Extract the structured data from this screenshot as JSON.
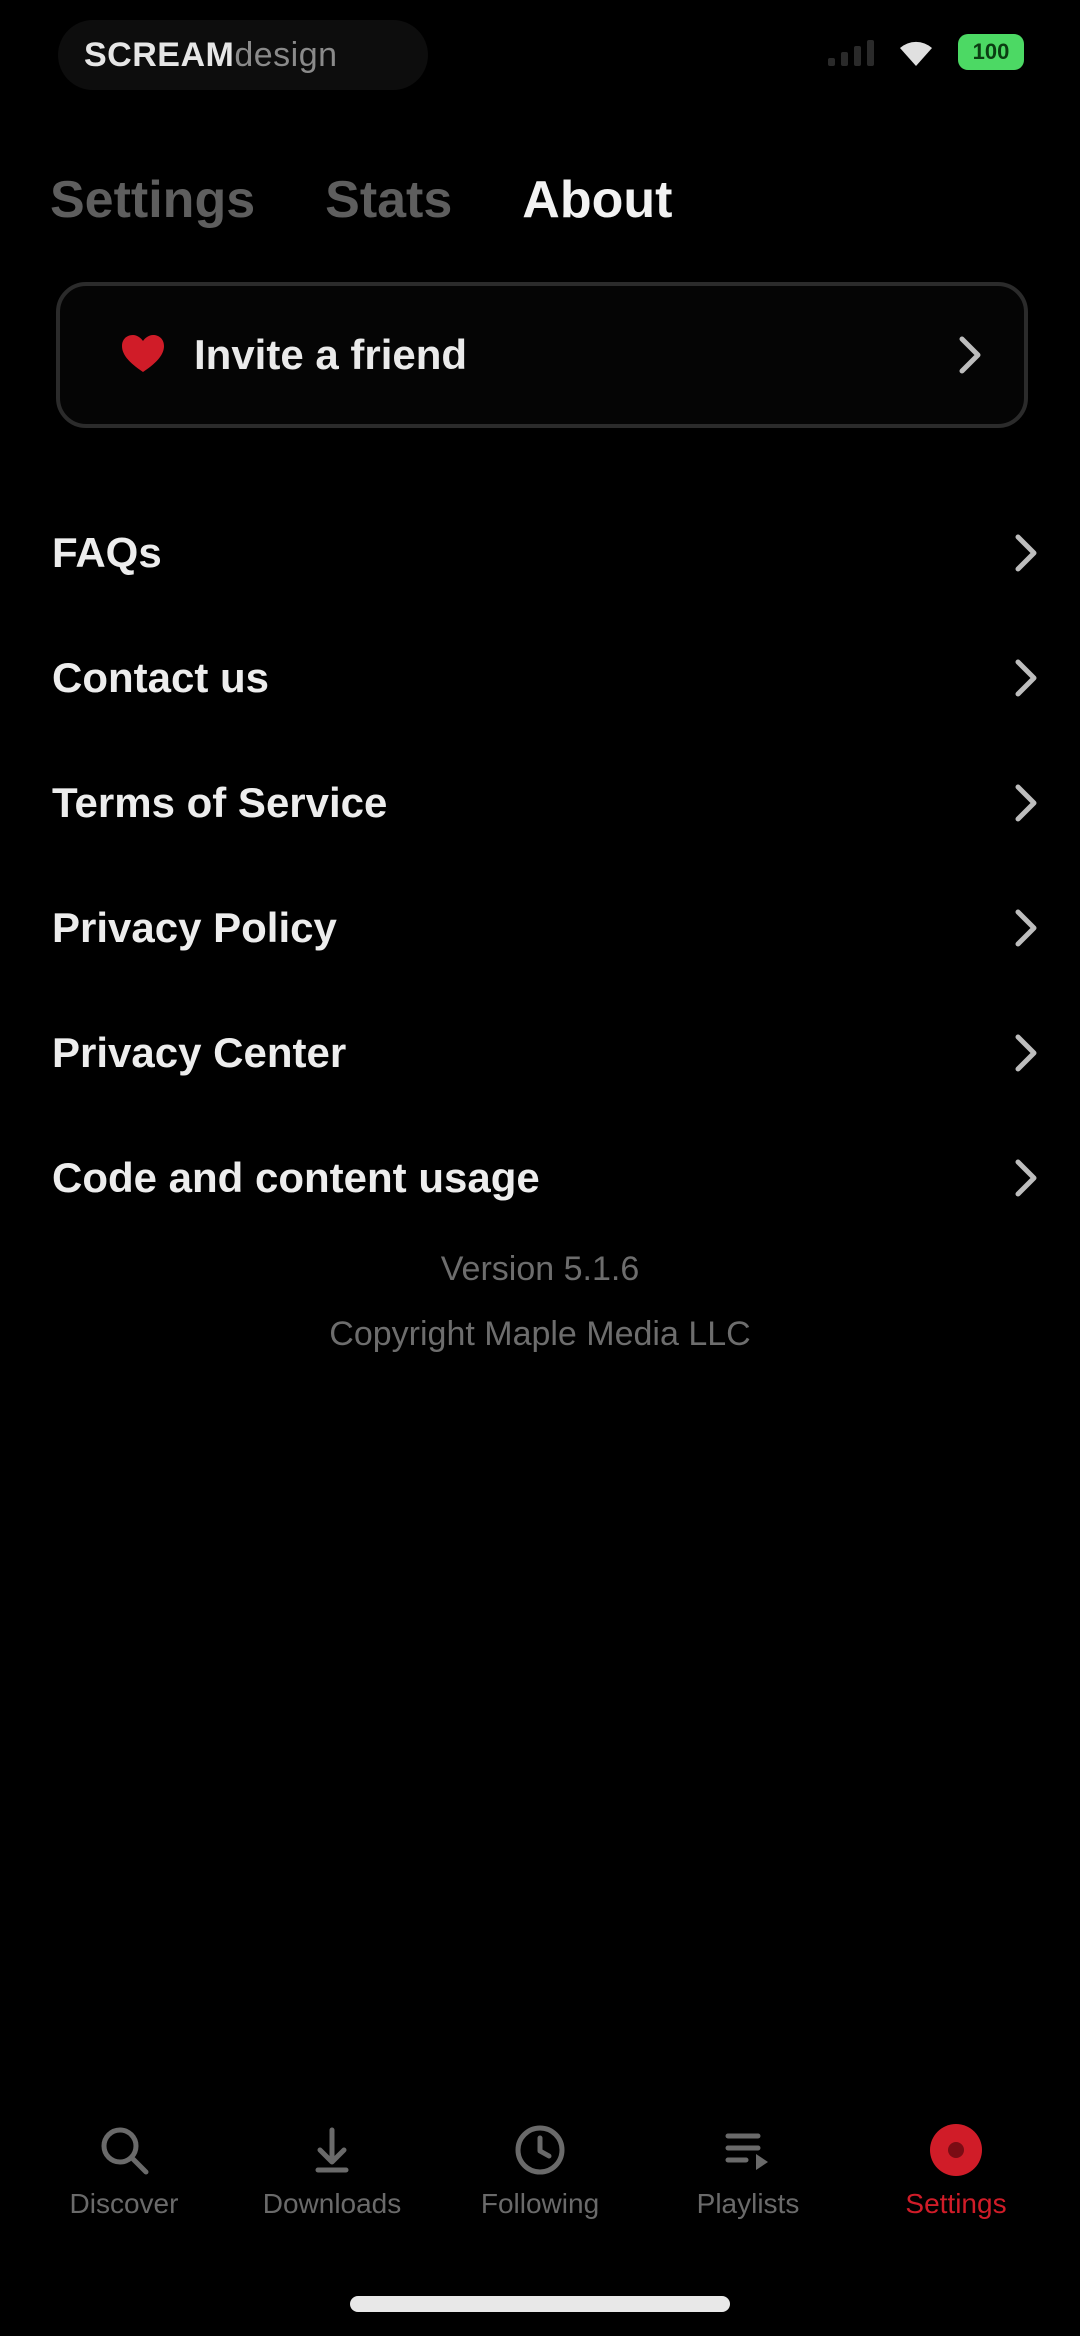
{
  "status_bar": {
    "app_brand": "SCREAM",
    "app_brand_sub": "design",
    "battery": "100"
  },
  "tabs": [
    {
      "label": "Settings",
      "active": false
    },
    {
      "label": "Stats",
      "active": false
    },
    {
      "label": "About",
      "active": true
    }
  ],
  "invite": {
    "label": "Invite a friend"
  },
  "menu": [
    {
      "label": "FAQs"
    },
    {
      "label": "Contact us"
    },
    {
      "label": "Terms of Service"
    },
    {
      "label": "Privacy Policy"
    },
    {
      "label": "Privacy Center"
    },
    {
      "label": "Code and content usage"
    }
  ],
  "footer": {
    "version": "Version 5.1.6",
    "copyright": "Copyright Maple Media LLC"
  },
  "bottom_nav": [
    {
      "label": "Discover",
      "icon": "search-icon",
      "active": false
    },
    {
      "label": "Downloads",
      "icon": "download-icon",
      "active": false
    },
    {
      "label": "Following",
      "icon": "clock-icon",
      "active": false
    },
    {
      "label": "Playlists",
      "icon": "playlist-icon",
      "active": false
    },
    {
      "label": "Settings",
      "icon": "settings-icon",
      "active": true
    }
  ],
  "colors": {
    "accent": "#d01c28",
    "background": "#000000",
    "battery": "#4cd964"
  }
}
